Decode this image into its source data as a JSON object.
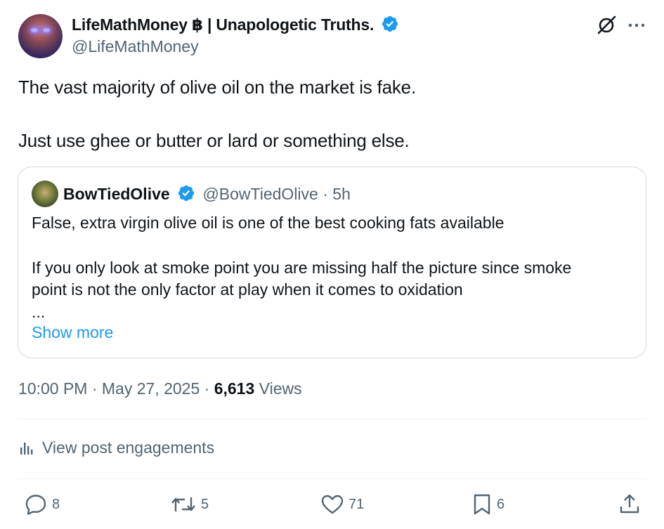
{
  "author": {
    "name": "LifeMathMoney ฿ | Unapologetic Truths.",
    "handle": "@LifeMathMoney"
  },
  "tweet": {
    "line1": "The vast majority of olive oil on the market is fake.",
    "line2": "Just use ghee or butter or lard or something else."
  },
  "quote": {
    "name": "BowTiedOlive",
    "handle_time": "@BowTiedOlive · 5h",
    "line1": "False, extra virgin olive oil is one of the best cooking fats available",
    "line2": "If you only look at smoke point you are missing half the picture since smoke",
    "line3": "point is not the only factor at play when it comes to oxidation",
    "ellipsis": "...",
    "show_more": "Show more"
  },
  "meta": {
    "time_date": "10:00 PM · May 27, 2025 · ",
    "views_count": "6,613",
    "views_label": " Views"
  },
  "engagements_label": "View post engagements",
  "actions": {
    "replies": "8",
    "reposts": "5",
    "likes": "71",
    "bookmarks": "6"
  },
  "colors": {
    "accent": "#1d9bf0",
    "secondary_text": "#536471",
    "border": "#cfd9de"
  },
  "icons": [
    "verified-badge-icon",
    "grok-icon",
    "more-icon",
    "analytics-icon",
    "reply-icon",
    "repost-icon",
    "like-icon",
    "bookmark-icon",
    "share-icon"
  ]
}
